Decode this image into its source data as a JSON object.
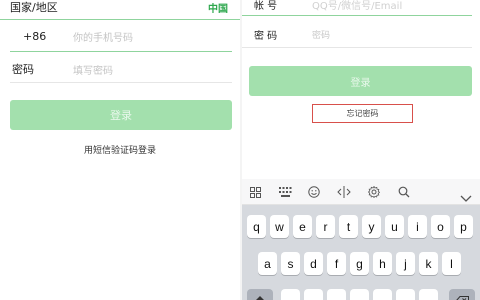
{
  "left": {
    "region_label": "国家/地区",
    "region_value": "中国",
    "country_code": "+86",
    "phone_placeholder": "你的手机号码",
    "password_label": "密码",
    "password_placeholder": "填写密码",
    "login_button": "登录",
    "sms_login_link": "用短信验证码登录"
  },
  "right": {
    "account_label": "帐 号",
    "account_placeholder": "QQ号/微信号/Email",
    "password_label": "密 码",
    "password_placeholder": "密码",
    "login_button": "登录",
    "forgot_password": "忘记密码"
  },
  "keyboard": {
    "toolbar": [
      "grid-icon",
      "keyboard-icon",
      "emoji-icon",
      "cursor-icon",
      "gear-icon",
      "search-icon",
      "collapse-icon"
    ],
    "row1": [
      "q",
      "w",
      "e",
      "r",
      "t",
      "y",
      "u",
      "i",
      "o",
      "p"
    ],
    "row2": [
      "a",
      "s",
      "d",
      "f",
      "g",
      "h",
      "j",
      "k",
      "l"
    ]
  },
  "colors": {
    "brand_green": "#2fa84f",
    "button_green": "#a3e0ad",
    "highlight_red": "#d8504b"
  }
}
